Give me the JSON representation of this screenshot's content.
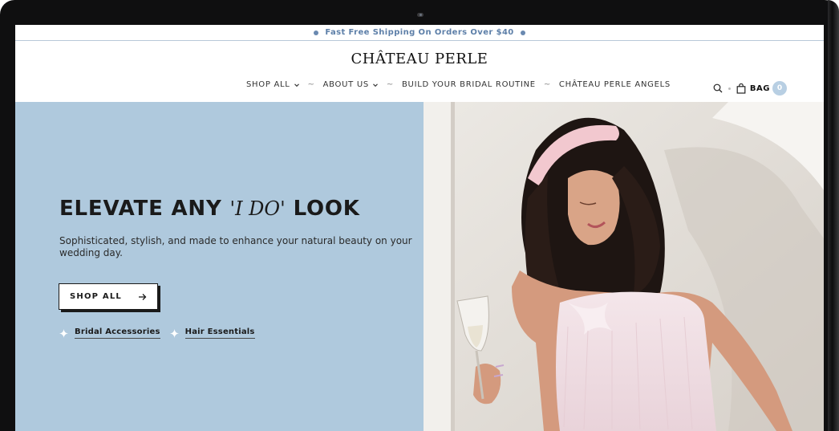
{
  "announcement": {
    "text": "Fast Free Shipping On Orders Over $40"
  },
  "header": {
    "logo": "CHÂTEAU PERLE",
    "nav": [
      {
        "label": "SHOP ALL",
        "dropdown": true
      },
      {
        "label": "ABOUT US",
        "dropdown": true
      },
      {
        "label": "BUILD YOUR BRIDAL ROUTINE",
        "dropdown": false
      },
      {
        "label": "CHÂTEAU PERLE ANGELS",
        "dropdown": false
      }
    ],
    "nav_separator": "~",
    "bag_label": "BAG",
    "bag_count": "0",
    "icons": [
      "search-icon",
      "bag-icon"
    ]
  },
  "hero": {
    "headline_before": "ELEVATE ANY",
    "headline_script": "'I DO'",
    "headline_after": "LOOK",
    "subtext": "Sophisticated, stylish, and made to enhance your natural beauty on your wedding day.",
    "cta_label": "SHOP ALL",
    "links": [
      "Bridal Accessories",
      "Hair Essentials"
    ],
    "image": "photo of a smiling woman with long dark hair, pink headband and pink ruffled dress holding a champagne flute"
  },
  "colors": {
    "accent": "#5d7fa8",
    "hero_bg": "#afc9dd",
    "bag_badge": "#b8cfe3",
    "text": "#1a1a1a"
  }
}
